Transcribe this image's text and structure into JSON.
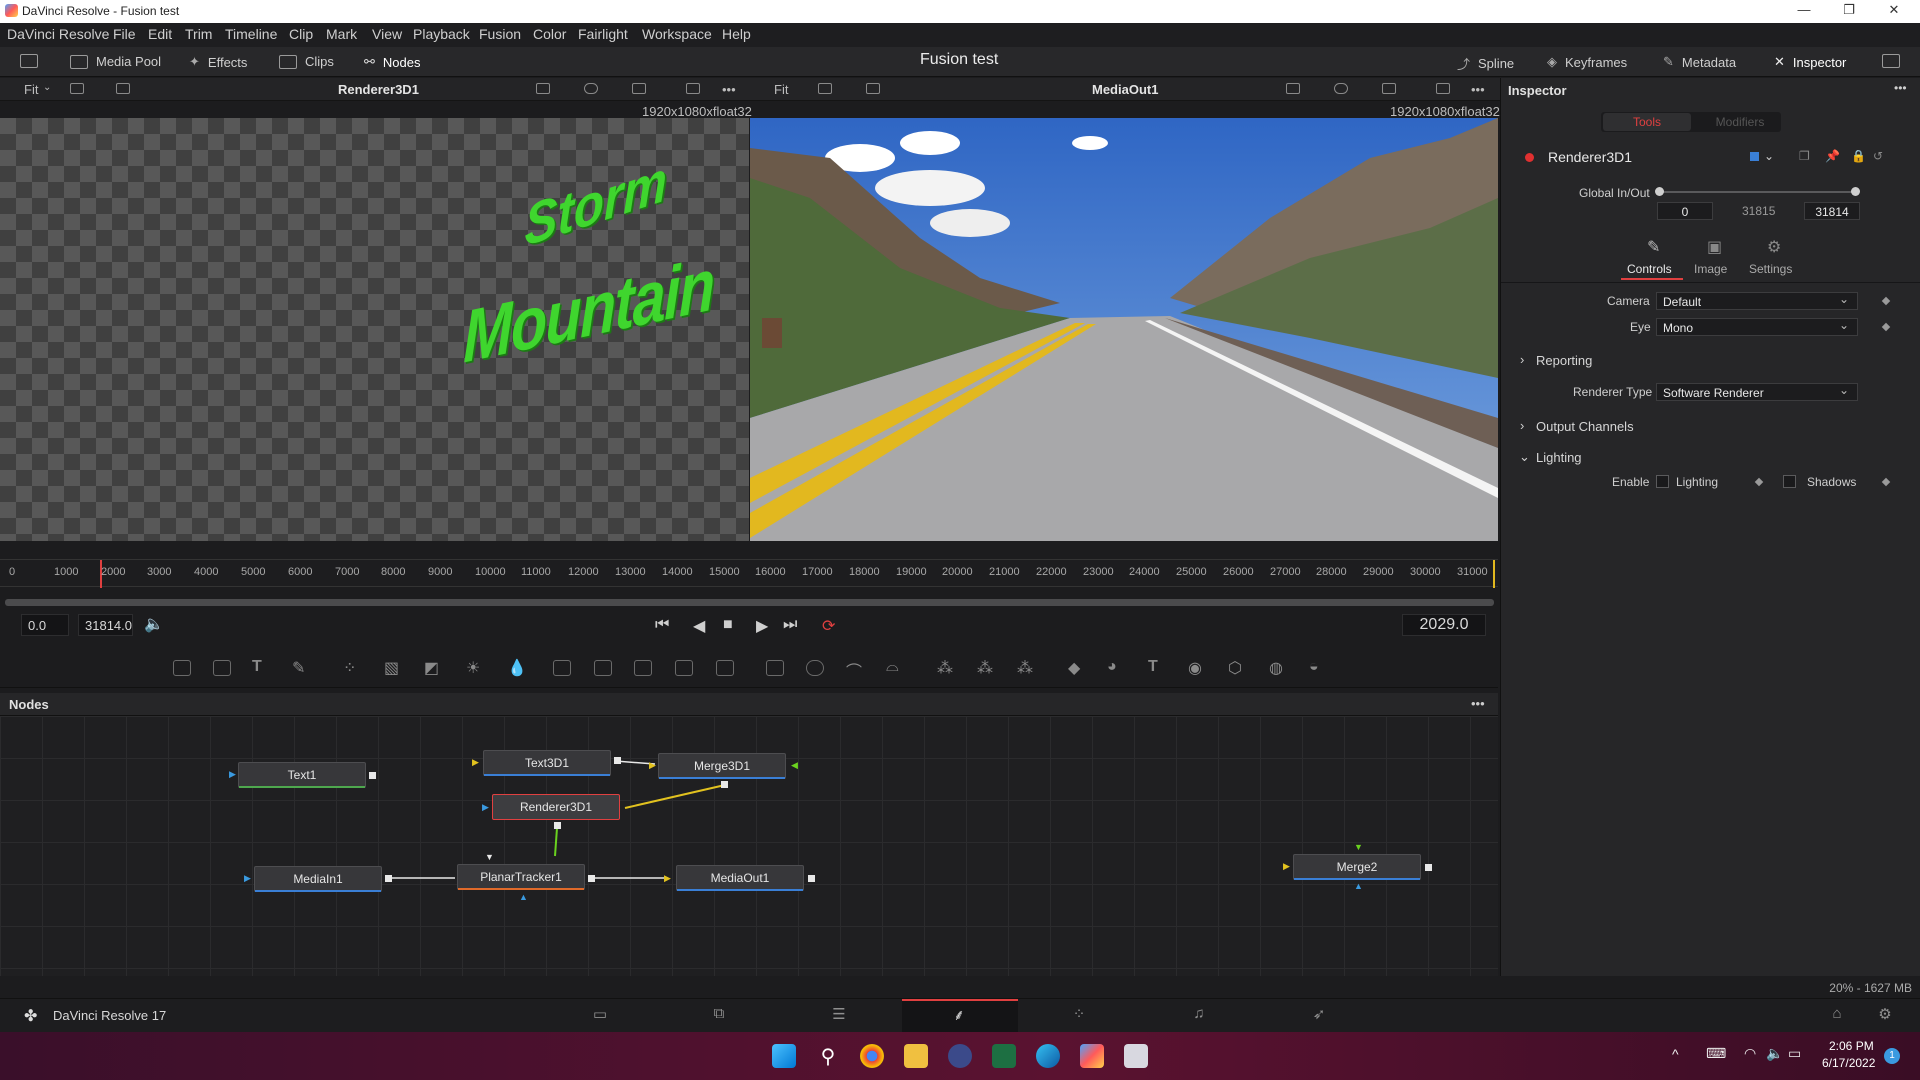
{
  "window": {
    "title": "DaVinci Resolve - Fusion test",
    "minimize": "—",
    "maximize": "❐",
    "close": "✕"
  },
  "menu": [
    "DaVinci Resolve",
    "File",
    "Edit",
    "Trim",
    "Timeline",
    "Clip",
    "Mark",
    "View",
    "Playback",
    "Fusion",
    "Color",
    "Fairlight",
    "Workspace",
    "Help"
  ],
  "toolbar": {
    "media_pool": "Media Pool",
    "effects": "Effects",
    "clips": "Clips",
    "nodes": "Nodes",
    "project": "Fusion test",
    "spline": "Spline",
    "keyframes": "Keyframes",
    "metadata": "Metadata",
    "inspector": "Inspector"
  },
  "viewer_left": {
    "fit": "Fit",
    "name": "Renderer3D1",
    "resolution": "1920x1080xfloat32",
    "text_line1": "Storm",
    "text_line2": "Mountain"
  },
  "viewer_right": {
    "fit": "Fit",
    "name": "MediaOut1",
    "resolution": "1920x1080xfloat32"
  },
  "ruler": {
    "ticks": [
      "0",
      "1000",
      "2000",
      "3000",
      "4000",
      "5000",
      "6000",
      "7000",
      "8000",
      "9000",
      "10000",
      "11000",
      "12000",
      "13000",
      "14000",
      "15000",
      "16000",
      "17000",
      "18000",
      "19000",
      "20000",
      "21000",
      "22000",
      "23000",
      "24000",
      "25000",
      "26000",
      "27000",
      "28000",
      "29000",
      "30000",
      "31000"
    ]
  },
  "transport": {
    "start": "0.0",
    "end": "31814.0",
    "current": "2029.0"
  },
  "nodes_panel": {
    "title": "Nodes",
    "items": {
      "text1": "Text1",
      "text3d1": "Text3D1",
      "merge3d1": "Merge3D1",
      "renderer3d1": "Renderer3D1",
      "mediain1": "MediaIn1",
      "planartracker1": "PlanarTracker1",
      "mediaout1": "MediaOut1",
      "merge2": "Merge2"
    }
  },
  "inspector": {
    "title": "Inspector",
    "tab_tools": "Tools",
    "tab_modifiers": "Modifiers",
    "node_name": "Renderer3D1",
    "global_label": "Global In/Out",
    "global_in": "0",
    "global_mid": "31815",
    "global_out": "31814",
    "subtab_controls": "Controls",
    "subtab_image": "Image",
    "subtab_settings": "Settings",
    "camera_label": "Camera",
    "camera_value": "Default",
    "eye_label": "Eye",
    "eye_value": "Mono",
    "reporting": "Reporting",
    "renderer_type_label": "Renderer Type",
    "renderer_type_value": "Software Renderer",
    "output_channels": "Output Channels",
    "lighting_section": "Lighting",
    "enable_label": "Enable",
    "lighting_checkbox": "Lighting",
    "shadows_checkbox": "Shadows"
  },
  "status": {
    "memory": "20% - 1627 MB"
  },
  "app_label": "DaVinci Resolve 17",
  "clock": {
    "time": "2:06 PM",
    "date": "6/17/2022",
    "notif": "1"
  }
}
